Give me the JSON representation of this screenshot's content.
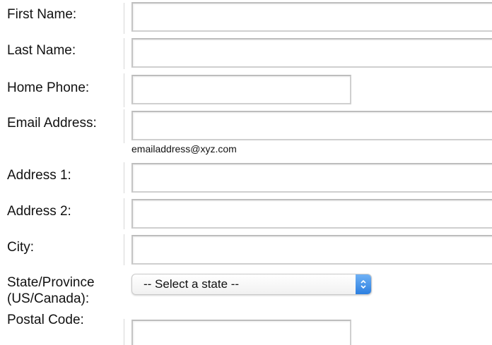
{
  "form": {
    "first_name": {
      "label": "First Name:",
      "value": ""
    },
    "last_name": {
      "label": "Last Name:",
      "value": ""
    },
    "home_phone": {
      "label": "Home Phone:",
      "value": ""
    },
    "email": {
      "label": "Email Address:",
      "value": "",
      "hint": "emailaddress@xyz.com"
    },
    "address1": {
      "label": "Address 1:",
      "value": ""
    },
    "address2": {
      "label": "Address 2:",
      "value": ""
    },
    "city": {
      "label": "City:",
      "value": ""
    },
    "state": {
      "label_line1": "State/Province",
      "label_line2": "(US/Canada):",
      "selected": "-- Select a state --"
    },
    "postal_code": {
      "label": "Postal Code:",
      "value": ""
    }
  },
  "icons": {
    "select_arrows": "up-down-chevron-icon"
  },
  "colors": {
    "select_accent": "#3a8ae8",
    "field_border": "#cfcfcf"
  }
}
